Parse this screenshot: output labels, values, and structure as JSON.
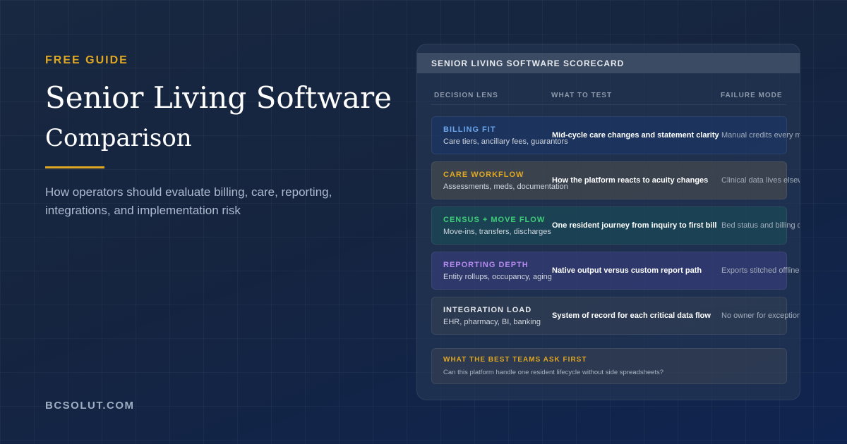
{
  "hero": {
    "eyebrow": "FREE GUIDE",
    "title_line1": "Senior Living Software",
    "title_line2": "Comparison",
    "subtitle": "How operators should evaluate billing, care, reporting, integrations, and implementation risk",
    "site": "BCSOLUT.COM"
  },
  "scorecard": {
    "title": "SENIOR LIVING SOFTWARE SCORECARD",
    "columns": [
      "DECISION LENS",
      "WHAT TO TEST",
      "FAILURE MODE"
    ],
    "rows": [
      {
        "label": "BILLING FIT",
        "sub": "Care tiers, ancillary fees, guarantors",
        "test": "Mid-cycle care changes and statement clarity",
        "failure": "Manual credits every month",
        "accent": "#69a4ec"
      },
      {
        "label": "CARE WORKFLOW",
        "sub": "Assessments, meds, documentation",
        "test": "How the platform reacts to acuity changes",
        "failure": "Clinical data lives elsewhere",
        "accent": "#e0a722"
      },
      {
        "label": "CENSUS + MOVE FLOW",
        "sub": "Move-ins, transfers, discharges",
        "test": "One resident journey from inquiry to first bill",
        "failure": "Bed status and billing disagree",
        "accent": "#3fce78"
      },
      {
        "label": "REPORTING DEPTH",
        "sub": "Entity rollups, occupancy, aging",
        "test": "Native output versus custom report path",
        "failure": "Exports stitched offline",
        "accent": "#b68af0"
      },
      {
        "label": "INTEGRATION LOAD",
        "sub": "EHR, pharmacy, BI, banking",
        "test": "System of record for each critical data flow",
        "failure": "No owner for exceptions",
        "accent": "#e6e9ee"
      }
    ],
    "callout": {
      "title": "WHAT THE BEST TEAMS ASK FIRST",
      "text": "Can this platform handle one resident lifecycle without side spreadsheets?"
    }
  },
  "colors": {
    "gold": "#e0a722",
    "background": "#15243f"
  }
}
